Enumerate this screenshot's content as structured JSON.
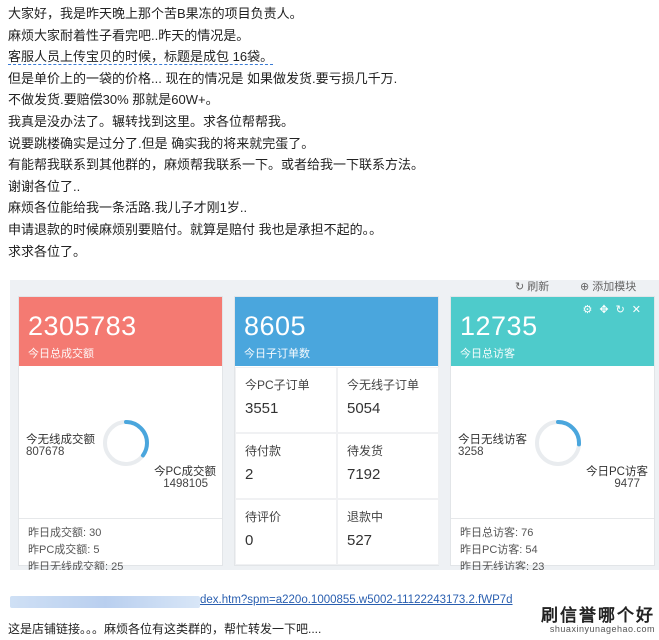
{
  "post_lines": [
    "大家好，我是昨天晚上那个苦B果冻的项目负责人。",
    "麻烦大家耐着性子看完吧..昨天的情况是。",
    "客服人员上传宝贝的时候，标题是成包 16袋。",
    "但是单价上的一袋的价格... 现在的情况是 如果做发货.要亏损几千万.",
    "不做发货.要赔偿30% 那就是60W+。",
    "我真是没办法了。辗转找到这里。求各位帮帮我。",
    "说要跳楼确实是过分了.但是  确实我的将来就完蛋了。",
    "有能帮我联系到其他群的，麻烦帮我联系一下。或者给我一下联系方法。",
    "谢谢各位了..",
    "麻烦各位能给我一条活路.我儿子才刚1岁..",
    "申请退款的时候麻烦别要赔付。就算是赔付 我也是承担不起的。。",
    "求求各位了。"
  ],
  "dashboard": {
    "top_buttons": [
      "刷新",
      "添加模块"
    ],
    "card_sales": {
      "big": "2305783",
      "sub": "今日总成交额",
      "wireless_label": "今无线成交额",
      "wireless_value": "807678",
      "pc_label": "今PC成交额",
      "pc_value": "1498105",
      "wireless_share": 0.35,
      "footer": [
        "昨日成交额: 30",
        "昨PC成交额: 5",
        "昨日无线成交额: 25"
      ]
    },
    "card_orders": {
      "big": "8605",
      "sub": "今日子订单数",
      "cells": [
        {
          "label": "今PC子订单",
          "value": "3551"
        },
        {
          "label": "今无线子订单",
          "value": "5054"
        },
        {
          "label": "待付款",
          "value": "2"
        },
        {
          "label": "待发货",
          "value": "7192"
        },
        {
          "label": "待评价",
          "value": "0"
        },
        {
          "label": "退款中",
          "value": "527"
        }
      ]
    },
    "card_visitors": {
      "big": "12735",
      "sub": "今日总访客",
      "wireless_label": "今日无线访客",
      "wireless_value": "3258",
      "pc_label": "今日PC访客",
      "pc_value": "9477",
      "wireless_share": 0.26,
      "footer": [
        "昨日总访客: 76",
        "昨日PC访客: 54",
        "昨日无线访客: 23"
      ]
    },
    "colors": {
      "sales": "#f47a72",
      "orders": "#4aa6dd",
      "visitors": "#4ecbcb",
      "ring": "#4aa6dd"
    }
  },
  "link_text": "dex.htm?spm=a220o.1000855.w5002-11122243173.2.fWP7d",
  "bottom_text": "这是店铺链接。。。麻烦各位有这类群的，帮忙转发一下吧....",
  "watermark": {
    "brand": "刷信誉哪个好",
    "site": "shuaxinyunagehao.com"
  }
}
